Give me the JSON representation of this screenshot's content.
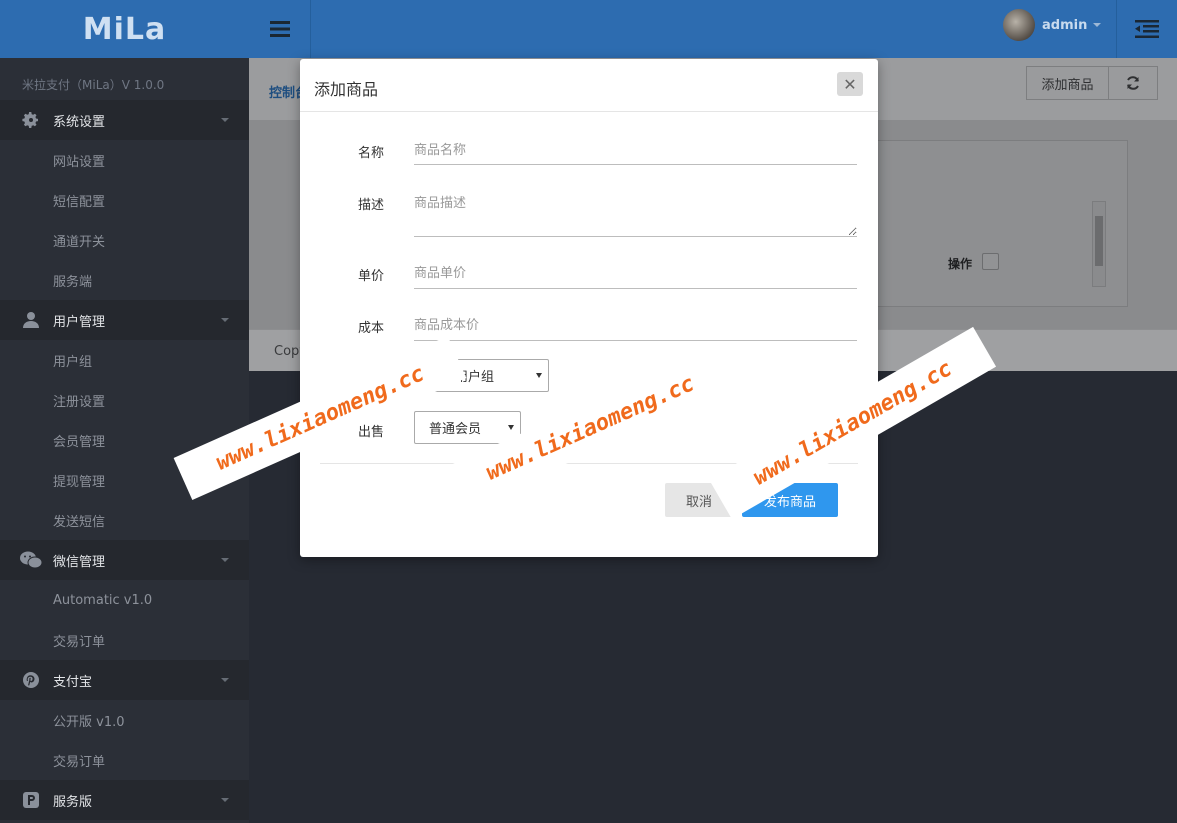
{
  "sidebar": {
    "logo": "MiLa",
    "version": "米拉支付（MiLa）V 1.0.0",
    "groups": [
      {
        "label": "系统设置",
        "icon": "gear-icon",
        "items": [
          "网站设置",
          "短信配置",
          "通道开关",
          "服务端"
        ]
      },
      {
        "label": "用户管理",
        "icon": "user-icon",
        "items": [
          "用户组",
          "注册设置",
          "会员管理",
          "提现管理",
          "发送短信"
        ]
      },
      {
        "label": "微信管理",
        "icon": "wechat-icon",
        "items": [
          "Automatic v1.0",
          "交易订单"
        ]
      },
      {
        "label": "支付宝",
        "icon": "pinterest-icon",
        "items": [
          "公开版 v1.0",
          "交易订单"
        ]
      },
      {
        "label": "服务版",
        "icon": "p-square-icon",
        "items": []
      }
    ]
  },
  "header": {
    "username": "admin"
  },
  "content": {
    "breadcrumb": "控制台",
    "add_button": "添加商品",
    "op_label": "操作",
    "copyright": "Copy"
  },
  "modal": {
    "title": "添加商品",
    "fields": {
      "name": {
        "label": "名称",
        "placeholder": "商品名称"
      },
      "desc": {
        "label": "描述",
        "placeholder": "商品描述"
      },
      "price": {
        "label": "单价",
        "placeholder": "商品单价"
      },
      "cost": {
        "label": "成本",
        "placeholder": "商品成本价"
      },
      "sale_group": {
        "value": "出售用户组"
      },
      "sale": {
        "label": "出售",
        "value": "普通会员"
      }
    },
    "cancel_label": "取消",
    "publish_label": "发布商品"
  },
  "watermark": "www.lixiaomeng.cc"
}
